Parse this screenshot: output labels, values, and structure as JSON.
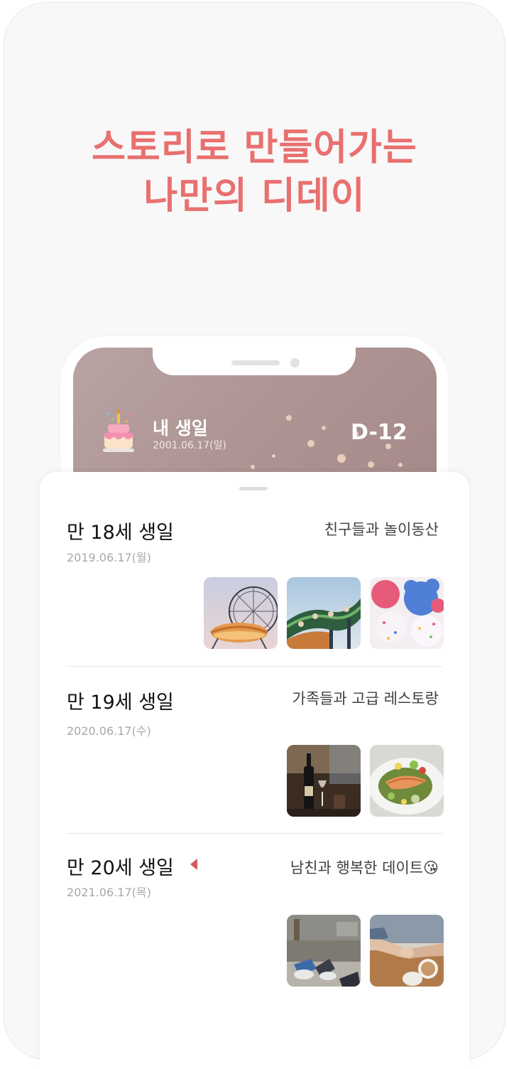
{
  "headline": {
    "line1": "스토리로 만들어가는",
    "line2": "나만의 디데이"
  },
  "dday": {
    "title": "내 생일",
    "date": "2001.06.17(일)",
    "count": "D-12"
  },
  "entries": [
    {
      "title": "만 18세 생일",
      "date": "2019.06.17(월)",
      "note": "친구들과 놀이동산",
      "photos": [
        "ferris-wheel-photo",
        "roller-coaster-photo",
        "birthday-balloons-photo"
      ]
    },
    {
      "title": "만 19세 생일",
      "date": "2020.06.17(수)",
      "note": "가족들과 고급 레스토랑",
      "photos": [
        "wine-bottle-photo",
        "salmon-dish-photo"
      ]
    },
    {
      "title": "만 20세 생일",
      "date": "2021.06.17(목)",
      "note": "남친과 행복한 데이트😘",
      "photos": [
        "sneakers-photo",
        "holding-hands-photo"
      ]
    }
  ],
  "colors": {
    "accent": "#e8706f",
    "marker": "#d45a5a"
  }
}
